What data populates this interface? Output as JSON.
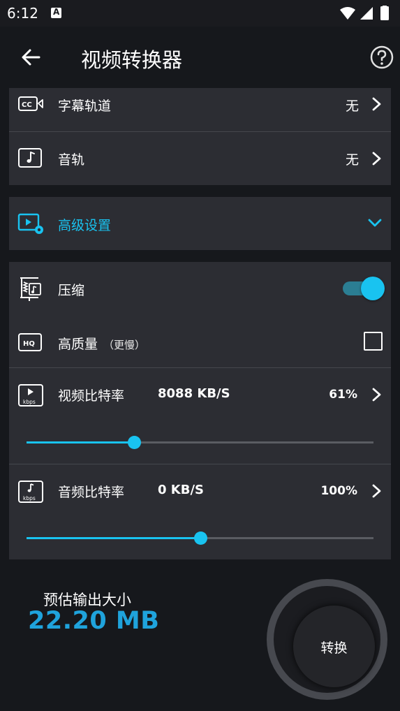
{
  "status_bar": {
    "time": "6:12"
  },
  "app_bar": {
    "title": "视频转换器"
  },
  "tracks": {
    "subtitle": {
      "label": "字幕轨道",
      "value": "无"
    },
    "audio": {
      "label": "音轨",
      "value": "无"
    }
  },
  "advanced": {
    "label": "高级设置"
  },
  "settings": {
    "compress": {
      "label": "压缩",
      "enabled": true
    },
    "high_quality": {
      "label": "高质量",
      "note": "（更慢）",
      "checked": false
    },
    "video_bitrate": {
      "label": "视频比特率",
      "value": "8088 KB/S",
      "percent": "61%",
      "slider_level": 0.31
    },
    "audio_bitrate": {
      "label": "音频比特率",
      "value": "0 KB/S",
      "percent": "100%",
      "slider_level": 0.5
    }
  },
  "estimate": {
    "label": "预估输出大小",
    "value": "22.20 MB"
  },
  "convert": {
    "label": "转换"
  },
  "colors": {
    "accent": "#19c3f0",
    "size_text": "#1fa3dc",
    "card_bg": "#2c2d33",
    "page_bg": "#16181c"
  }
}
